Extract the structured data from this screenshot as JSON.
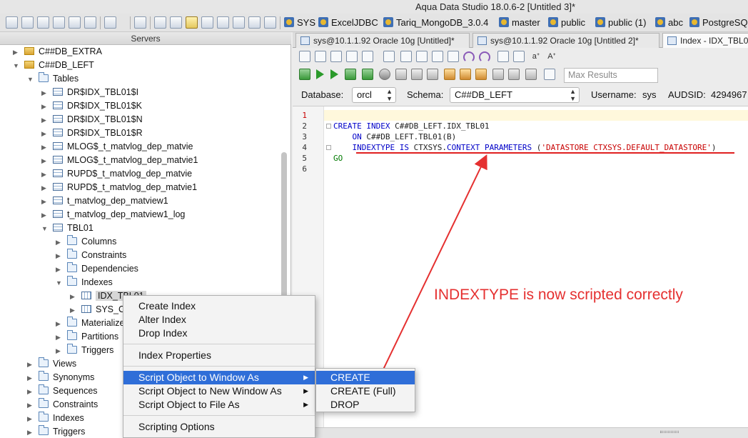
{
  "window": {
    "title": "Aqua Data Studio 18.0.6-2 [Untitled 3]*"
  },
  "toolbar": {
    "connections": [
      "SYS",
      "ExcelJDBC",
      "Tariq_MongoDB_3.0.4",
      "master",
      "public",
      "public (1)",
      "abc",
      "PostgreSQ"
    ]
  },
  "servers": {
    "header": "Servers",
    "tree": [
      {
        "label": "C##DB_EXTRA",
        "icon": "schema-icon",
        "expander": "▶"
      },
      {
        "label": "C##DB_LEFT",
        "icon": "schema-icon",
        "expander": "▼"
      },
      {
        "label": "Tables",
        "icon": "folder-icon",
        "expander": "▼"
      },
      {
        "label": "DR$IDX_TBL01$I",
        "icon": "table-icon",
        "expander": "▶"
      },
      {
        "label": "DR$IDX_TBL01$K",
        "icon": "table-icon",
        "expander": "▶"
      },
      {
        "label": "DR$IDX_TBL01$N",
        "icon": "table-icon",
        "expander": "▶"
      },
      {
        "label": "DR$IDX_TBL01$R",
        "icon": "table-icon",
        "expander": "▶"
      },
      {
        "label": "MLOG$_t_matvlog_dep_matvie",
        "icon": "table-icon",
        "expander": "▶"
      },
      {
        "label": "MLOG$_t_matvlog_dep_matvie1",
        "icon": "table-icon",
        "expander": "▶"
      },
      {
        "label": "RUPD$_t_matvlog_dep_matvie",
        "icon": "table-icon",
        "expander": "▶"
      },
      {
        "label": "RUPD$_t_matvlog_dep_matvie1",
        "icon": "table-icon",
        "expander": "▶"
      },
      {
        "label": "t_matvlog_dep_matview1",
        "icon": "table-icon",
        "expander": "▶"
      },
      {
        "label": "t_matvlog_dep_matview1_log",
        "icon": "table-icon",
        "expander": "▶"
      },
      {
        "label": "TBL01",
        "icon": "table-icon",
        "expander": "▼"
      },
      {
        "label": "Columns",
        "icon": "folder-icon",
        "expander": "▶"
      },
      {
        "label": "Constraints",
        "icon": "folder-icon",
        "expander": "▶"
      },
      {
        "label": "Dependencies",
        "icon": "folder-icon",
        "expander": "▶"
      },
      {
        "label": "Indexes",
        "icon": "folder-icon",
        "expander": "▼"
      },
      {
        "label": "IDX_TBL01",
        "icon": "index-icon",
        "expander": "▶"
      },
      {
        "label": "SYS_CO",
        "icon": "index-icon",
        "expander": "▶"
      },
      {
        "label": "Materialize",
        "icon": "folder-icon",
        "expander": "▶"
      },
      {
        "label": "Partitions",
        "icon": "folder-icon",
        "expander": "▶"
      },
      {
        "label": "Triggers",
        "icon": "folder-icon",
        "expander": "▶"
      },
      {
        "label": "Views",
        "icon": "folder-icon",
        "expander": "▶"
      },
      {
        "label": "Synonyms",
        "icon": "folder-icon",
        "expander": "▶"
      },
      {
        "label": "Sequences",
        "icon": "folder-icon",
        "expander": "▶"
      },
      {
        "label": "Constraints",
        "icon": "folder-icon",
        "expander": "▶"
      },
      {
        "label": "Indexes",
        "icon": "folder-icon",
        "expander": "▶"
      },
      {
        "label": "Triggers",
        "icon": "folder-icon",
        "expander": "▶"
      }
    ]
  },
  "tabs": [
    {
      "label": "sys@10.1.1.92 Oracle 10g [Untitled]*"
    },
    {
      "label": "sys@10.1.1.92 Oracle 10g [Untitled 2]*"
    },
    {
      "label": "Index - IDX_TBL0"
    }
  ],
  "editor_toolbar": {
    "max_results_placeholder": "Max Results"
  },
  "connection_bar": {
    "database_label": "Database:",
    "database_value": "orcl",
    "schema_label": "Schema:",
    "schema_value": "C##DB_LEFT",
    "username_label": "Username:",
    "username_value": "sys",
    "audsid_label": "AUDSID:",
    "audsid_value": "4294967"
  },
  "editor": {
    "line_numbers": [
      "1",
      "2",
      "3",
      "4",
      "5",
      "6"
    ],
    "code": {
      "l2_kw1": "CREATE INDEX",
      "l2_rest": " C##DB_LEFT.IDX_TBL01",
      "l3_indent": "    ",
      "l3_kw": "ON",
      "l3_rest": " C##DB_LEFT.TBL01(B)",
      "l4_indent": "    ",
      "l4_kw1": "INDEXTYPE IS",
      "l4_mid1": " CTXSYS.",
      "l4_kw2": "CONTEXT PARAMETERS",
      "l4_mid2": " (",
      "l4_str": "'DATASTORE CTXSYS.DEFAULT_DATASTORE'",
      "l4_end": ")",
      "l5_go": "GO"
    },
    "annotation": "INDEXTYPE is now scripted correctly",
    "annotation_color": "#e53030"
  },
  "context_menu": {
    "items": [
      "Create Index",
      "Alter Index",
      "Drop Index",
      "Index Properties",
      "Script Object to Window As",
      "Script Object to New Window As",
      "Script Object to File As",
      "Scripting Options"
    ],
    "highlight_color": "#2f6ed8"
  },
  "submenu": {
    "items": [
      "CREATE",
      "CREATE (Full)",
      "DROP"
    ]
  }
}
